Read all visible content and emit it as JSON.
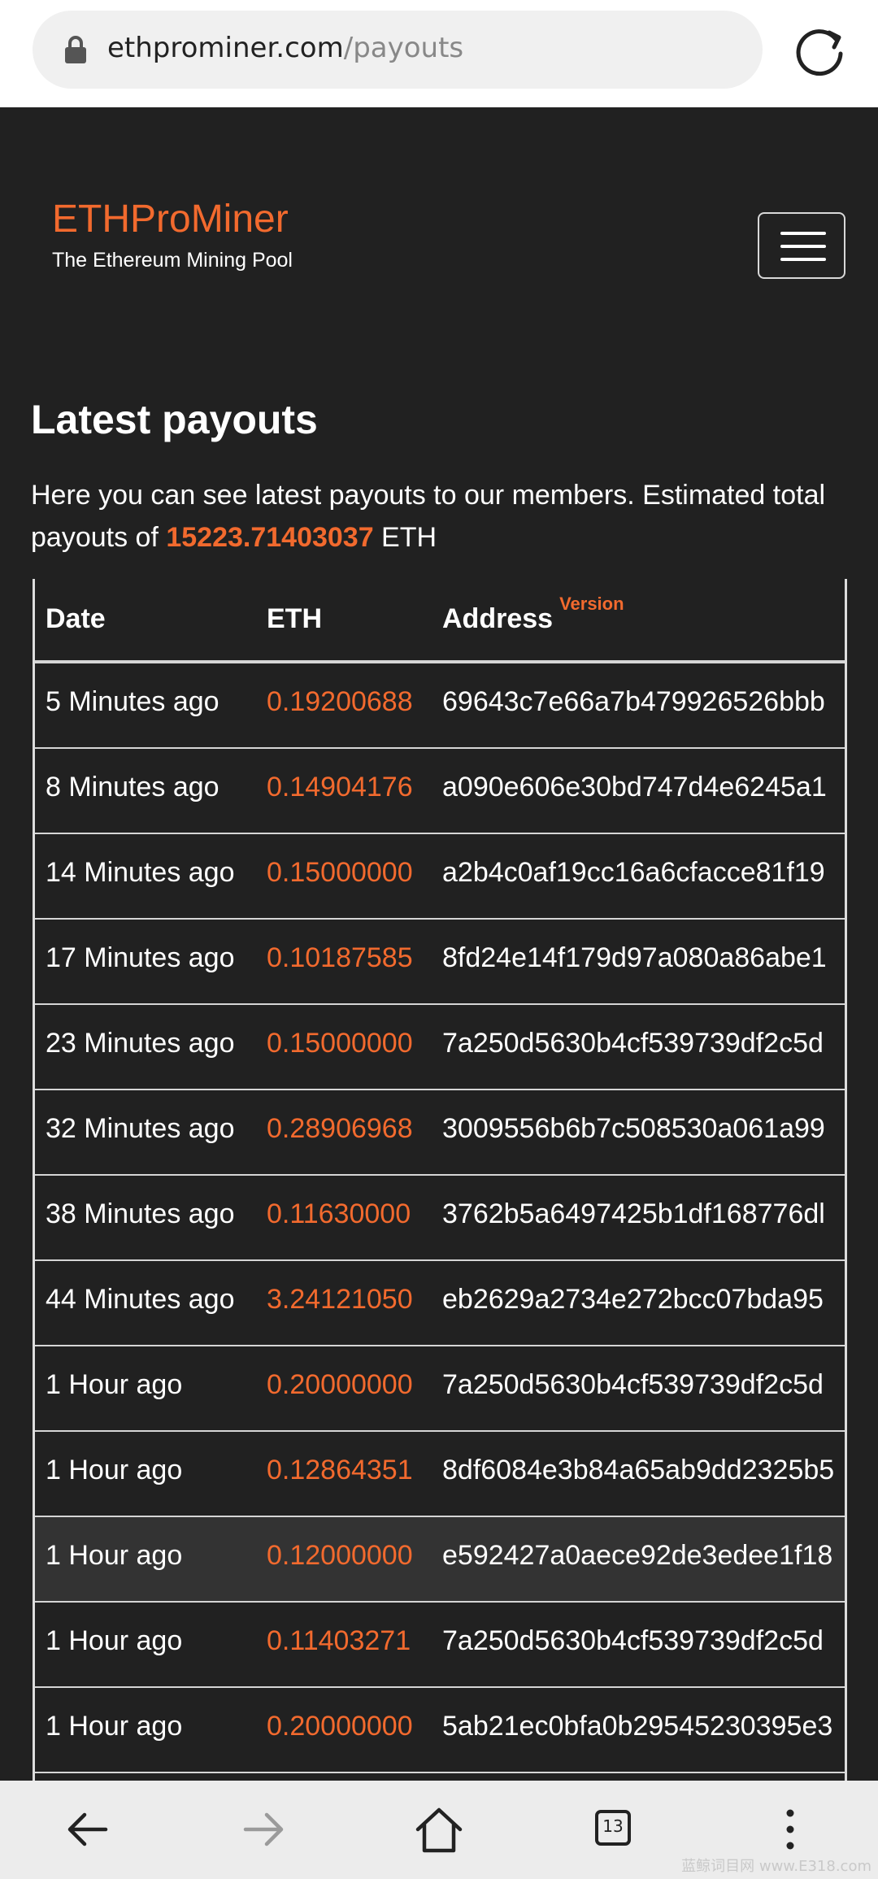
{
  "browser": {
    "url_domain": "ethprominer.com",
    "url_path": "/payouts",
    "tab_count": "13"
  },
  "site": {
    "brand": "ETHProMiner",
    "tagline": "The Ethereum Mining Pool"
  },
  "page": {
    "heading": "Latest payouts",
    "intro_text": "Here you can see latest payouts to our members. Estimated total payouts of ",
    "total": "15223.71403037",
    "unit": " ETH"
  },
  "table": {
    "headers": {
      "date": "Date",
      "eth": "ETH",
      "address": "Address",
      "version": "Version"
    },
    "rows": [
      {
        "date": "5 Minutes ago",
        "eth": "0.19200688",
        "address": "69643c7e66a7b479926526bbb"
      },
      {
        "date": "8 Minutes ago",
        "eth": "0.14904176",
        "address": "a090e606e30bd747d4e6245a1"
      },
      {
        "date": "14 Minutes ago",
        "eth": "0.15000000",
        "address": "a2b4c0af19cc16a6cfacce81f19"
      },
      {
        "date": "17 Minutes ago",
        "eth": "0.10187585",
        "address": "8fd24e14f179d97a080a86abe1"
      },
      {
        "date": "23 Minutes ago",
        "eth": "0.15000000",
        "address": "7a250d5630b4cf539739df2c5d"
      },
      {
        "date": "32 Minutes ago",
        "eth": "0.28906968",
        "address": "3009556b6b7c508530a061a99"
      },
      {
        "date": "38 Minutes ago",
        "eth": "0.11630000",
        "address": "3762b5a6497425b1df168776dl"
      },
      {
        "date": "44 Minutes ago",
        "eth": "3.24121050",
        "address": "eb2629a2734e272bcc07bda95"
      },
      {
        "date": "1 Hour ago",
        "eth": "0.20000000",
        "address": "7a250d5630b4cf539739df2c5d"
      },
      {
        "date": "1 Hour ago",
        "eth": "0.12864351",
        "address": "8df6084e3b84a65ab9dd2325b5"
      },
      {
        "date": "1 Hour ago",
        "eth": "0.12000000",
        "address": "e592427a0aece92de3edee1f18"
      },
      {
        "date": "1 Hour ago",
        "eth": "0.11403271",
        "address": "7a250d5630b4cf539739df2c5d"
      },
      {
        "date": "1 Hour ago",
        "eth": "0.20000000",
        "address": "5ab21ec0bfa0b29545230395e3"
      }
    ]
  },
  "watermark": "蓝鲸词目网 www.E318.com",
  "colors": {
    "accent": "#f26a2e",
    "background": "#212121"
  }
}
